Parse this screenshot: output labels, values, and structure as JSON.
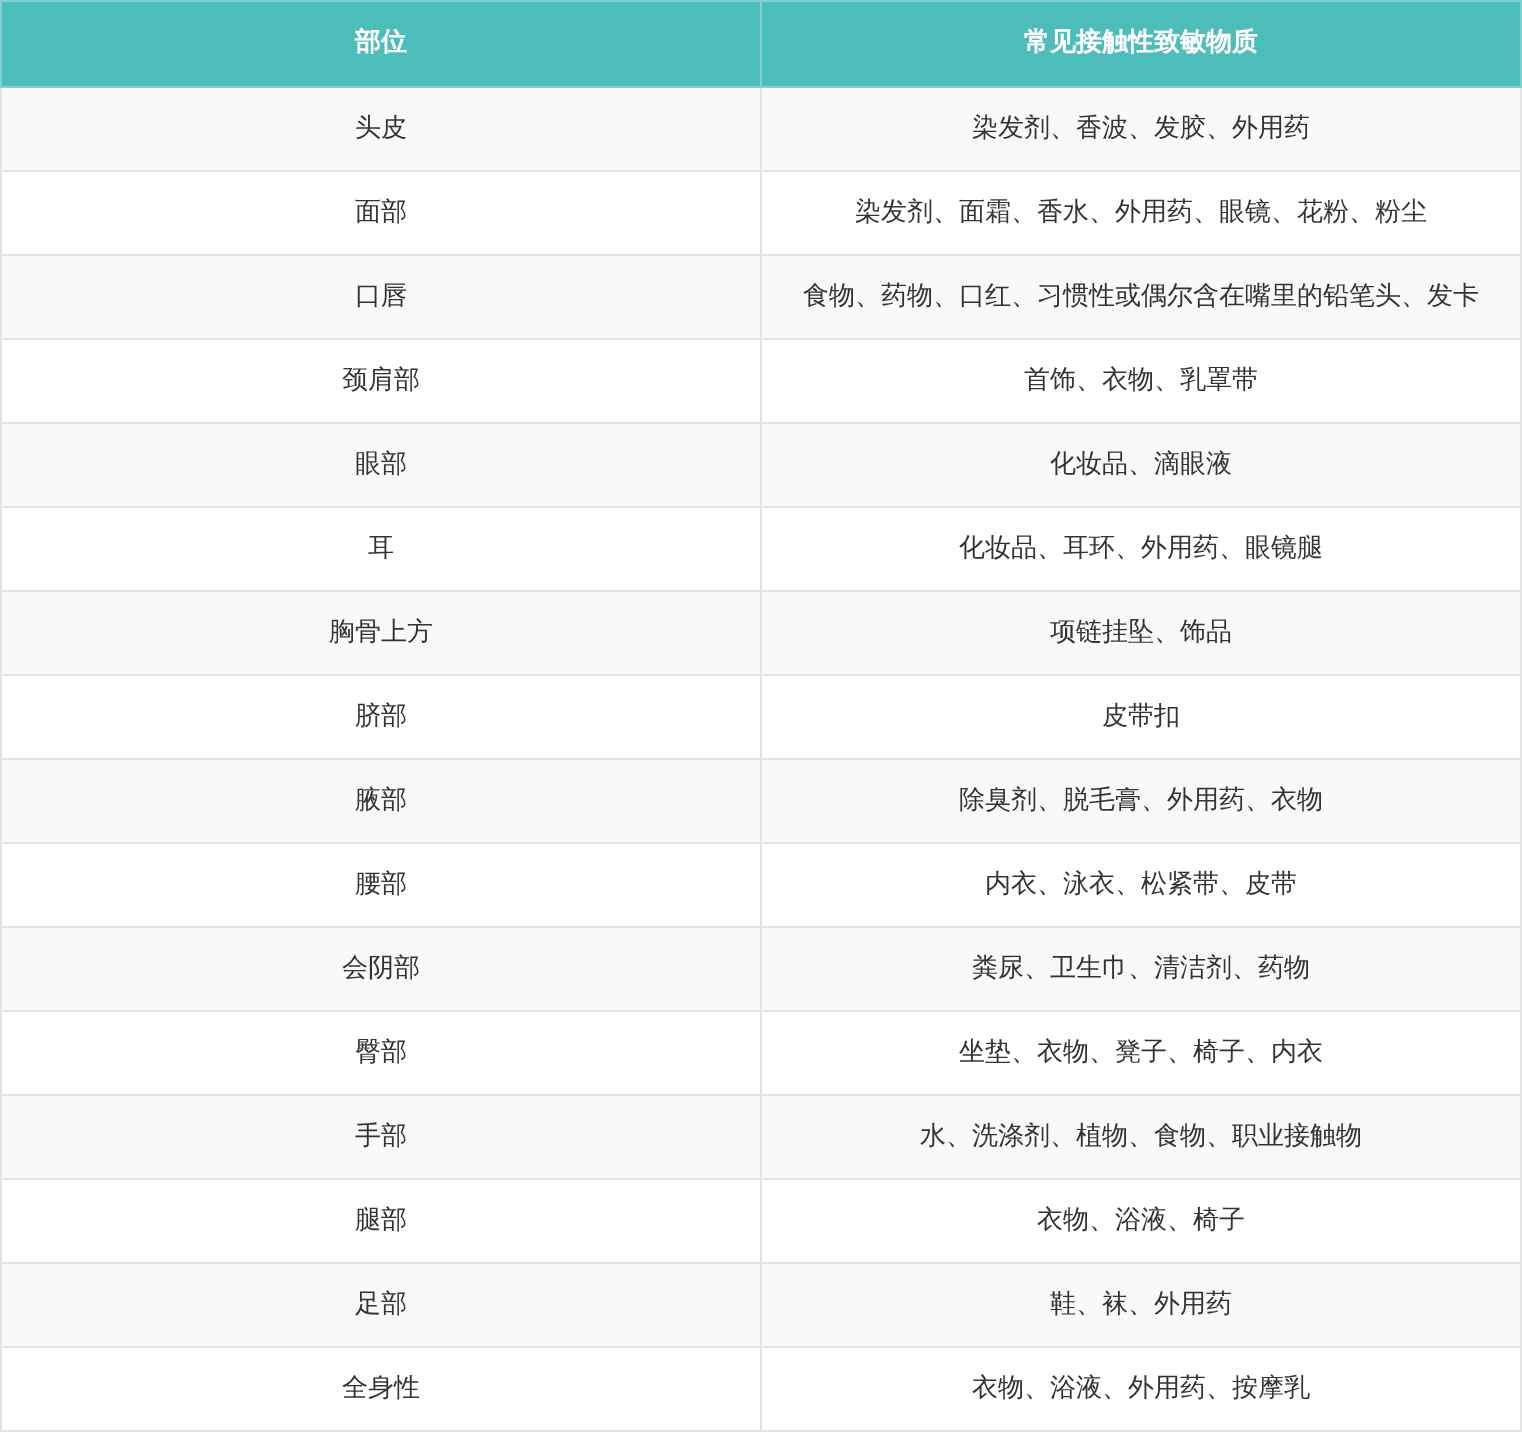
{
  "table": {
    "columns": [
      "部位",
      "常见接触性致敏物质"
    ],
    "rows": [
      [
        "头皮",
        "染发剂、香波、发胶、外用药"
      ],
      [
        "面部",
        "染发剂、面霜、香水、外用药、眼镜、花粉、粉尘"
      ],
      [
        "口唇",
        "食物、药物、口红、习惯性或偶尔含在嘴里的铅笔头、发卡"
      ],
      [
        "颈肩部",
        "首饰、衣物、乳罩带"
      ],
      [
        "眼部",
        "化妆品、滴眼液"
      ],
      [
        "耳",
        "化妆品、耳环、外用药、眼镜腿"
      ],
      [
        "胸骨上方",
        "项链挂坠、饰品"
      ],
      [
        "脐部",
        "皮带扣"
      ],
      [
        "腋部",
        "除臭剂、脱毛膏、外用药、衣物"
      ],
      [
        "腰部",
        "内衣、泳衣、松紧带、皮带"
      ],
      [
        "会阴部",
        "粪尿、卫生巾、清洁剂、药物"
      ],
      [
        "臀部",
        "坐垫、衣物、凳子、椅子、内衣"
      ],
      [
        "手部",
        "水、洗涤剂、植物、食物、职业接触物"
      ],
      [
        "腿部",
        "衣物、浴液、椅子"
      ],
      [
        "足部",
        "鞋、袜、外用药"
      ],
      [
        "全身性",
        "衣物、浴液、外用药、按摩乳"
      ]
    ]
  }
}
